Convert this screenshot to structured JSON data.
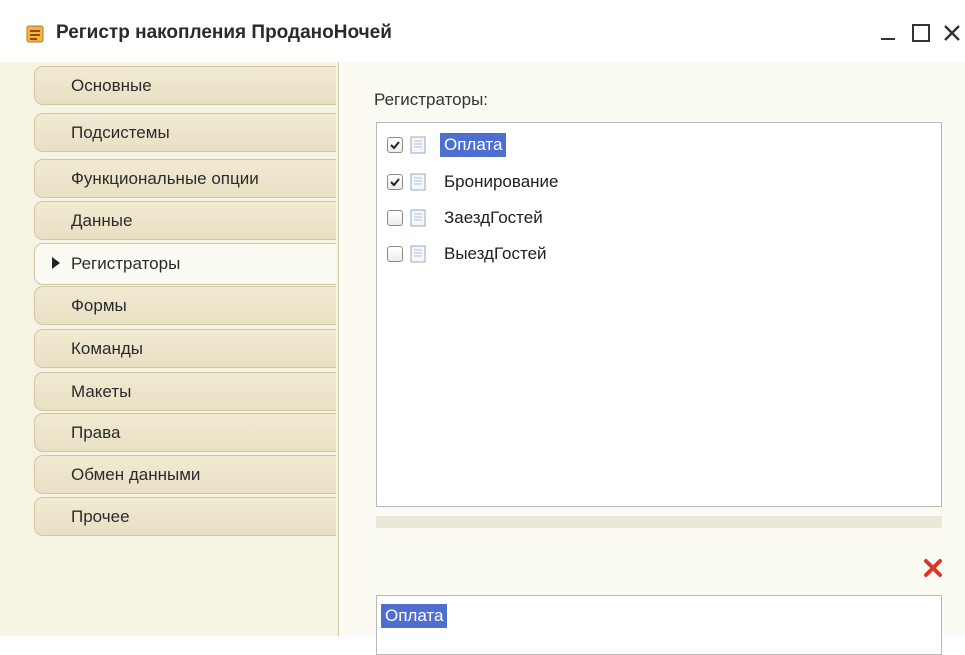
{
  "window": {
    "title": "Регистр накопления ПроданоНочей"
  },
  "tabs": [
    {
      "label": "Основные",
      "active": false
    },
    {
      "label": "Подсистемы",
      "active": false
    },
    {
      "label": "Функциональные опции",
      "active": false
    },
    {
      "label": "Данные",
      "active": false
    },
    {
      "label": "Регистраторы",
      "active": true
    },
    {
      "label": "Формы",
      "active": false
    },
    {
      "label": "Команды",
      "active": false
    },
    {
      "label": "Макеты",
      "active": false
    },
    {
      "label": "Права",
      "active": false
    },
    {
      "label": "Обмен данными",
      "active": false
    },
    {
      "label": "Прочее",
      "active": false
    }
  ],
  "registrators": {
    "label": "Регистраторы:",
    "items": [
      {
        "name": "Оплата",
        "checked": true,
        "selected": true
      },
      {
        "name": "Бронирование",
        "checked": true,
        "selected": false
      },
      {
        "name": "ЗаездГостей",
        "checked": false,
        "selected": false
      },
      {
        "name": "ВыездГостей",
        "checked": false,
        "selected": false
      }
    ]
  },
  "details": {
    "value": "Оплата"
  },
  "icons": {
    "title": "register-icon",
    "minimize": "minimize-icon",
    "maximize": "maximize-icon",
    "close": "close-icon",
    "delete": "delete-icon",
    "document": "document-icon"
  },
  "colors": {
    "selection": "#4f6fd0",
    "delete": "#d9362b",
    "tab_background": "#ebe2c8"
  }
}
